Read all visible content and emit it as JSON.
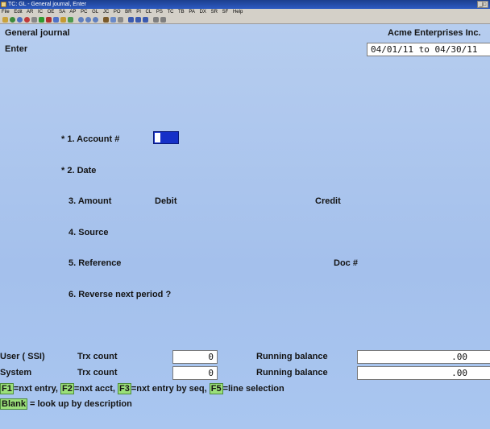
{
  "window": {
    "title": "TC: GL - General journal, Enter",
    "controls": "_|□"
  },
  "menu": [
    "File",
    "Edit",
    "AR",
    "IC",
    "OE",
    "SA",
    "AP",
    "PC",
    "GL",
    "JC",
    "PO",
    "BR",
    "PI",
    "CL",
    "PS",
    "TC",
    "TB",
    "PA",
    "DX",
    "SR",
    "SF",
    "Help"
  ],
  "header": {
    "screen_title": "General journal",
    "mode": "Enter",
    "company": "Acme Enterprises Inc.",
    "period": "04/01/11 to 04/30/11"
  },
  "form": {
    "f1": "* 1. Account #",
    "f2": "* 2. Date",
    "f3": "3. Amount",
    "debit": "Debit",
    "credit": "Credit",
    "f4": "4. Source",
    "f5": "5. Reference",
    "doc": "Doc #",
    "f6": "6. Reverse next period ?"
  },
  "totals": {
    "user_label": "User ( SSI)",
    "system_label": "System",
    "trx_count_label": "Trx count",
    "running_balance_label": "Running balance",
    "user_trx_count": "0",
    "user_running_balance": ".00",
    "system_trx_count": "0",
    "system_running_balance": ".00"
  },
  "help": {
    "f1_key": "F1",
    "f1_text": "=nxt entry, ",
    "f2_key": "F2",
    "f2_text": "=nxt acct, ",
    "f3_key": "F3",
    "f3_text": "=nxt entry by seq, ",
    "f5_key": "F5",
    "f5_text": "=line selection",
    "blank_key": "Blank",
    "blank_text": " = look up by description"
  }
}
